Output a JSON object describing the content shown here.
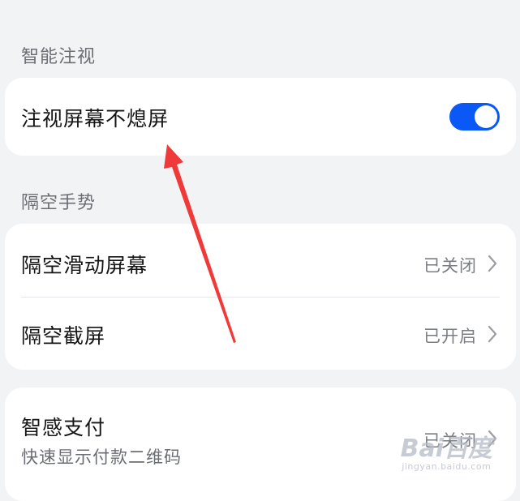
{
  "sections": {
    "smart_gaze": {
      "title": "智能注视",
      "item": {
        "label": "注视屏幕不熄屏",
        "toggle_on": true
      }
    },
    "air_gesture": {
      "title": "隔空手势",
      "items": [
        {
          "label": "隔空滑动屏幕",
          "value": "已关闭",
          "icon": "chevron-right-icon"
        },
        {
          "label": "隔空截屏",
          "value": "已开启",
          "icon": "chevron-right-icon"
        }
      ]
    },
    "smart_pay": {
      "label": "智感支付",
      "sub": "快速显示付款二维码",
      "value": "已关闭",
      "icon": "chevron-right-icon"
    }
  },
  "watermark": {
    "main": "Bai百度",
    "sub": "jingyan.baidu.com"
  },
  "colors": {
    "background": "#f1f3f5",
    "card": "#ffffff",
    "toggle_on": "#0a59f7",
    "annotation_arrow": "#f03a3a"
  }
}
